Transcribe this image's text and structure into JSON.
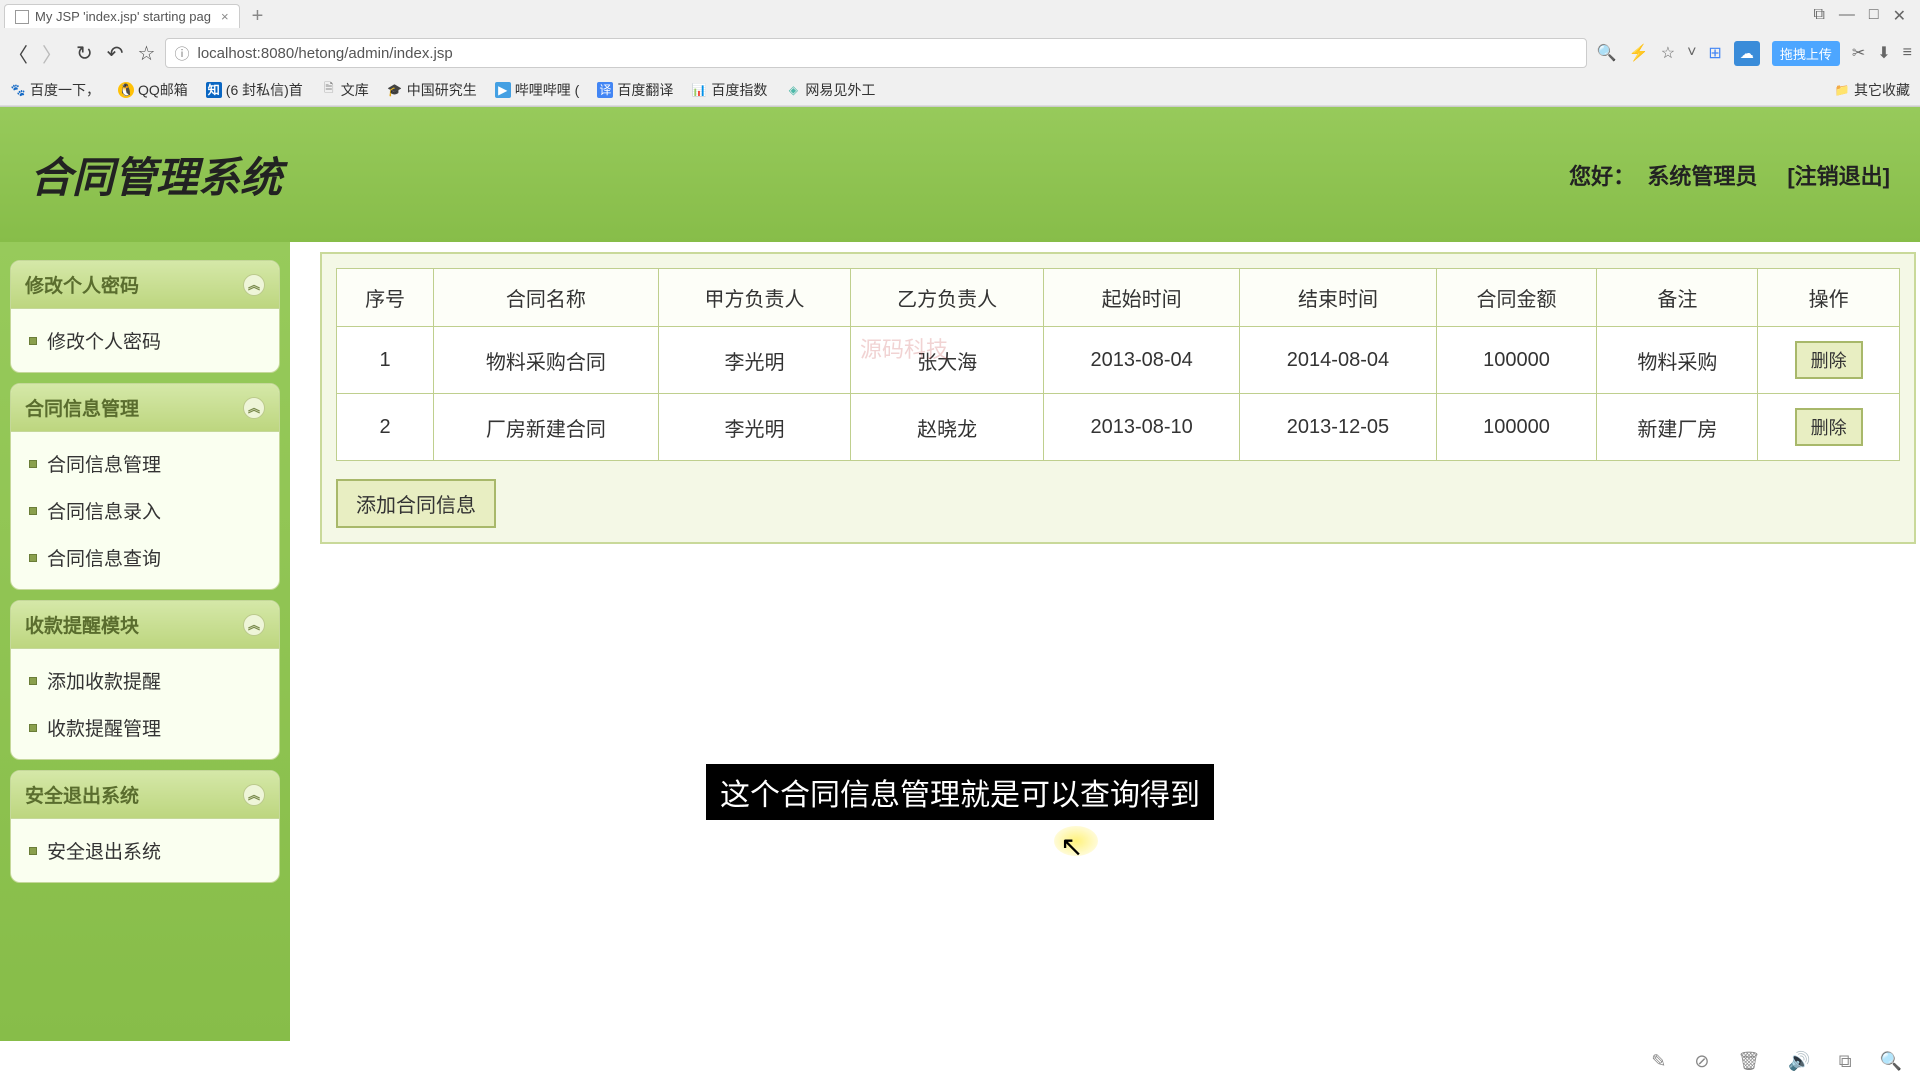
{
  "browser": {
    "tab_title": "My JSP 'index.jsp' starting pag",
    "url": "localhost:8080/hetong/admin/index.jsp",
    "upload_label": "拖拽上传",
    "bookmarks": [
      "百度一下，",
      "QQ邮箱",
      "(6 封私信)首",
      "文库",
      "中国研究生",
      "哔哩哔哩 (",
      "百度翻译",
      "百度指数",
      "网易见外工"
    ],
    "bookmark_right": "其它收藏"
  },
  "header": {
    "title": "合同管理系统",
    "greeting": "您好：",
    "user": "系统管理员",
    "logout": "[注销退出]"
  },
  "sidebar": {
    "panels": [
      {
        "title": "修改个人密码",
        "items": [
          "修改个人密码"
        ]
      },
      {
        "title": "合同信息管理",
        "items": [
          "合同信息管理",
          "合同信息录入",
          "合同信息查询"
        ]
      },
      {
        "title": "收款提醒模块",
        "items": [
          "添加收款提醒",
          "收款提醒管理"
        ]
      },
      {
        "title": "安全退出系统",
        "items": [
          "安全退出系统"
        ]
      }
    ]
  },
  "table": {
    "headers": [
      "序号",
      "合同名称",
      "甲方负责人",
      "乙方负责人",
      "起始时间",
      "结束时间",
      "合同金额",
      "备注",
      "操作"
    ],
    "rows": [
      {
        "c0": "1",
        "c1": "物料采购合同",
        "c2": "李光明",
        "c3": "张大海",
        "c4": "2013-08-04",
        "c5": "2014-08-04",
        "c6": "100000",
        "c7": "物料采购",
        "op": "删除"
      },
      {
        "c0": "2",
        "c1": "厂房新建合同",
        "c2": "李光明",
        "c3": "赵晓龙",
        "c4": "2013-08-10",
        "c5": "2013-12-05",
        "c6": "100000",
        "c7": "新建厂房",
        "op": "删除"
      }
    ],
    "add_button": "添加合同信息"
  },
  "watermark": "源码科技",
  "subtitle": "这个合同信息管理就是可以查询得到"
}
